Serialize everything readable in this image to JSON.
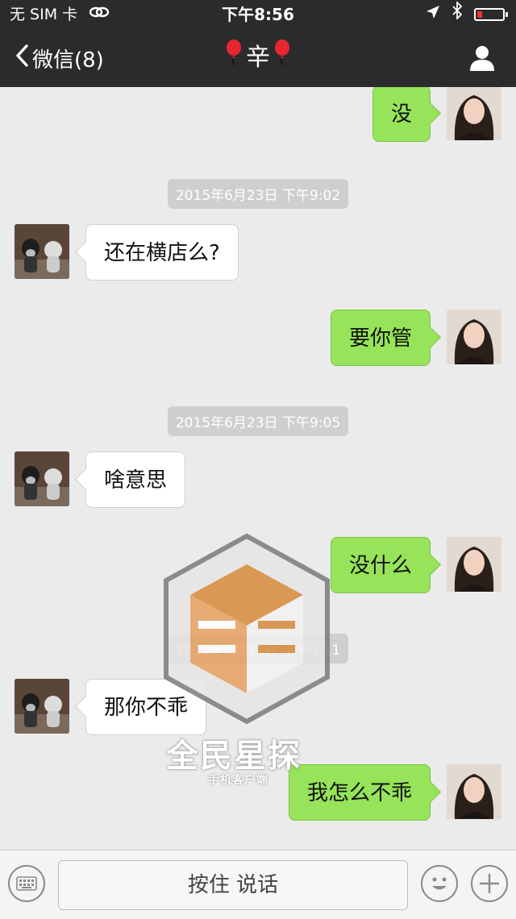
{
  "status_bar": {
    "carrier": "无 SIM 卡",
    "time": "下午8:56"
  },
  "nav": {
    "back_label": "微信(8)",
    "title": "辛"
  },
  "messages": [
    {
      "side": "out",
      "text": "没",
      "avatar": "girl-avatar"
    },
    {
      "side": "ts",
      "text": "2015年6月23日  下午9:02"
    },
    {
      "side": "in",
      "text": "还在横店么?",
      "avatar": "dogs-avatar"
    },
    {
      "side": "out",
      "text": "要你管",
      "avatar": "girl-avatar"
    },
    {
      "side": "ts",
      "text": "2015年6月23日  下午9:05"
    },
    {
      "side": "in",
      "text": "啥意思",
      "avatar": "dogs-avatar"
    },
    {
      "side": "out",
      "text": "没什么",
      "avatar": "girl-avatar"
    },
    {
      "side": "ts",
      "text": "2015年6月23日  下午9:11"
    },
    {
      "side": "in",
      "text": "那你不乖",
      "avatar": "dogs-avatar"
    },
    {
      "side": "out",
      "text": "我怎么不乖",
      "avatar": "girl-avatar"
    }
  ],
  "watermark": {
    "title": "全民星探",
    "subtitle": "手机客户端"
  },
  "input_bar": {
    "hold_to_talk": "按住 说话"
  },
  "colors": {
    "topbar": "#2b2b2d",
    "outgoing_bubble": "#97e35a",
    "incoming_bubble": "#ffffff",
    "chat_background": "#ebebeb"
  }
}
